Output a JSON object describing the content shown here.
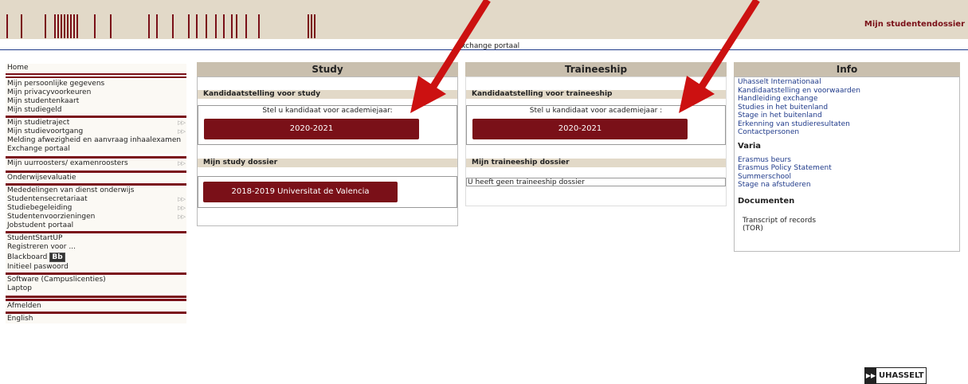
{
  "header": {
    "title": "Mijn studentendossier",
    "subtitle": "xchange portaal"
  },
  "sidebar": {
    "items": [
      {
        "label": "Home",
        "arrow": ""
      },
      {
        "label": "Mijn persoonlijke gegevens",
        "arrow": ""
      },
      {
        "label": "Mijn privacyvoorkeuren",
        "arrow": ""
      },
      {
        "label": "Mijn studentenkaart",
        "arrow": ""
      },
      {
        "label": "Mijn studiegeld",
        "arrow": ""
      },
      {
        "label": "Mijn studietraject",
        "arrow": "▷▷"
      },
      {
        "label": "Mijn studievoortgang",
        "arrow": "▷▷"
      },
      {
        "label": "Melding afwezigheid en aanvraag inhaalexamen",
        "arrow": ""
      },
      {
        "label": "Exchange portaal",
        "arrow": ""
      },
      {
        "label": "Mijn uurroosters/ examenroosters",
        "arrow": "▷▷"
      },
      {
        "label": "Onderwijsevaluatie",
        "arrow": ""
      },
      {
        "label": "Mededelingen van dienst onderwijs",
        "arrow": ""
      },
      {
        "label": "Studentensecretariaat",
        "arrow": "▷▷"
      },
      {
        "label": "Studiebegeleiding",
        "arrow": "▷▷"
      },
      {
        "label": "Studentenvoorzieningen",
        "arrow": "▷▷"
      },
      {
        "label": "Jobstudent portaal",
        "arrow": ""
      },
      {
        "label": "StudentStartUP",
        "arrow": ""
      },
      {
        "label": "Registreren voor ...",
        "arrow": ""
      },
      {
        "label": "Blackboard",
        "arrow": ""
      },
      {
        "label": "Initieel paswoord",
        "arrow": ""
      },
      {
        "label": "Software (Campuslicenties)",
        "arrow": ""
      },
      {
        "label": "Laptop",
        "arrow": ""
      },
      {
        "label": "Afmelden",
        "arrow": ""
      },
      {
        "label": "English",
        "arrow": ""
      }
    ],
    "blackboard_badge": "Bb"
  },
  "study": {
    "title": "Study",
    "candidacy_heading": "Kandidaatstelling voor study",
    "prompt": "Stel u kandidaat voor academiejaar:",
    "year_button": "2020-2021",
    "dossier_heading": "Mijn study dossier",
    "dossier_button": "2018-2019 Universitat de Valencia"
  },
  "traineeship": {
    "title": "Traineeship",
    "candidacy_heading": "Kandidaatstelling voor traineeship",
    "prompt": "Stel u kandidaat voor academiejaar :",
    "year_button": "2020-2021",
    "dossier_heading": "Mijn traineeship dossier",
    "dossier_text": "U heeft geen traineeship dossier"
  },
  "info": {
    "title": "Info",
    "links": [
      "Uhasselt Internationaal",
      "Kandidaatstelling en voorwaarden",
      "Handleiding exchange",
      "Studies in het buitenland",
      "Stage in het buitenland",
      "Erkenning van studieresultaten",
      "Contactpersonen"
    ],
    "varia_heading": "Varia",
    "varia_links": [
      "Erasmus beurs",
      "Erasmus Policy Statement",
      "Summerschool",
      "Stage na afstuderen"
    ],
    "documents_heading": "Documenten",
    "documents_text_1": "Transcript of records",
    "documents_text_2": "(TOR)"
  },
  "logo": {
    "text": "UHASSELT",
    "icon": "fast-forward-icon"
  },
  "colors": {
    "brand": "#7a1018",
    "header_bg": "#e2d9c8",
    "panel_head": "#c9bfae",
    "link": "#1f3a8a",
    "annotation_arrow": "#cc1111"
  }
}
